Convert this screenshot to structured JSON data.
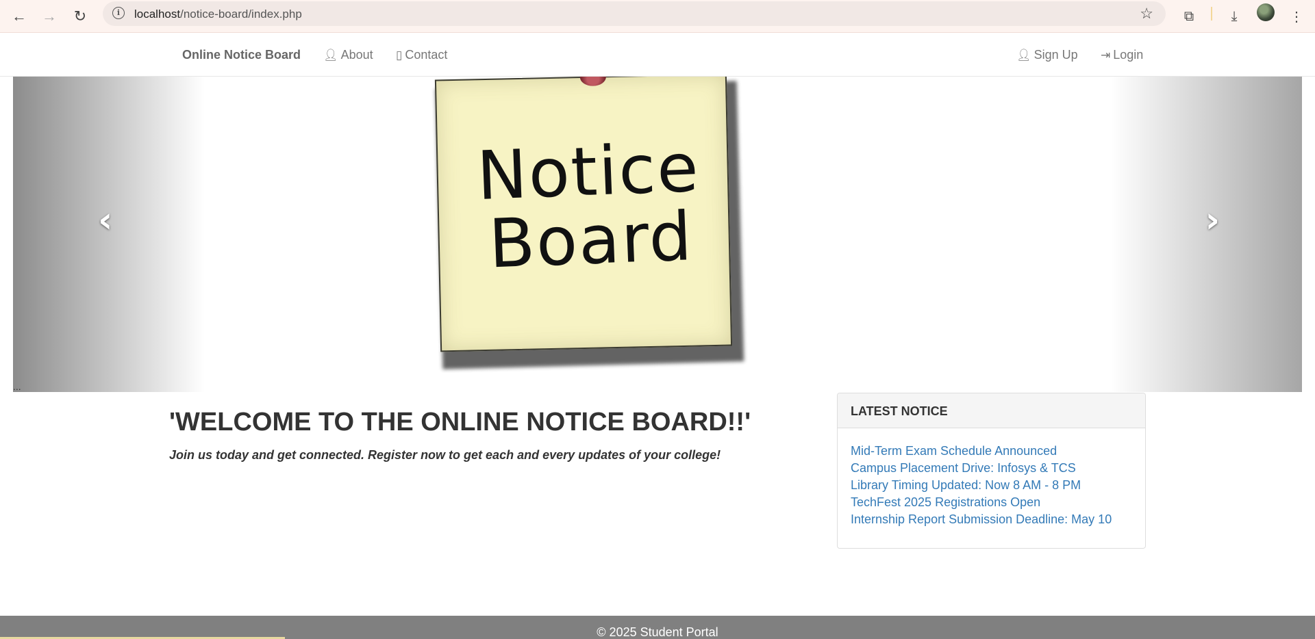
{
  "browser": {
    "url_host": "localhost",
    "url_path": "/notice-board/index.php"
  },
  "nav": {
    "brand": "Online Notice Board",
    "about": "About",
    "contact": "Contact",
    "signup": "Sign Up",
    "login": "Login"
  },
  "carousel": {
    "note_line1": "Notice",
    "note_line2": "Board",
    "caption": "..."
  },
  "welcome": {
    "title": "'WELCOME TO THE ONLINE NOTICE BOARD!!'",
    "subtitle": "Join us today and get connected. Register now to get each and every updates of your college!"
  },
  "latest_notice": {
    "heading": "LATEST NOTICE",
    "items": [
      "Mid-Term Exam Schedule Announced",
      "Campus Placement Drive: Infosys & TCS",
      "Library Timing Updated: Now 8 AM - 8 PM",
      "TechFest 2025 Registrations Open",
      "Internship Report Submission Deadline: May 10"
    ]
  },
  "footer": {
    "text": "© 2025 Student Portal"
  }
}
